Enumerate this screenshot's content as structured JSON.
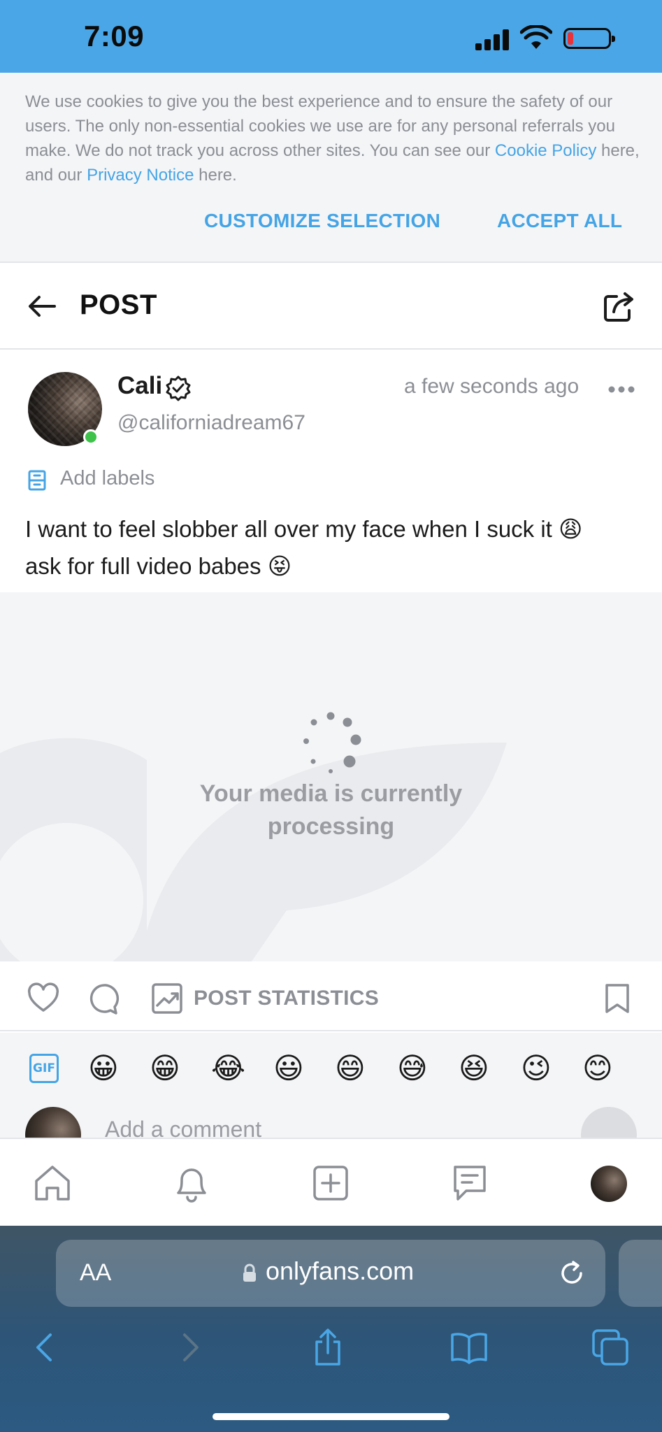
{
  "status_bar": {
    "time": "7:09"
  },
  "cookie_banner": {
    "text_1": "We use cookies to give you the best experience and to ensure the safety of our users. The only non-essential cookies we use are for any personal referrals you make. We do not track you across other sites. You can see our ",
    "cookie_policy_link": "Cookie Policy",
    "text_2": " here, and our ",
    "privacy_link": "Privacy Notice",
    "text_3": " here.",
    "customize_label": "CUSTOMIZE SELECTION",
    "accept_label": "ACCEPT ALL"
  },
  "header": {
    "title": "POST"
  },
  "post": {
    "author_name": "Cali",
    "author_handle": "@californiadream67",
    "time": "a few seconds ago",
    "add_labels": "Add labels",
    "text_line_1": "I want to feel slobber all over my face when I suck it ",
    "emoji_1": "😩",
    "text_line_2": " ask for full video babes ",
    "emoji_2": "😝",
    "media_status": "Your media is currently processing"
  },
  "actions": {
    "stats_label": "POST STATISTICS"
  },
  "comment": {
    "gif_label": "GIF",
    "emojis": [
      "😀",
      "😁",
      "😂",
      "😃",
      "😄",
      "😅",
      "😆",
      "😉",
      "😊"
    ],
    "placeholder": "Add a comment"
  },
  "browser": {
    "aa_label": "AA",
    "url": "onlyfans.com"
  },
  "colors": {
    "accent": "#45a4e5",
    "status_bar": "#4aa6e6",
    "online": "#3ec24a",
    "muted_text": "#8b8e94"
  }
}
